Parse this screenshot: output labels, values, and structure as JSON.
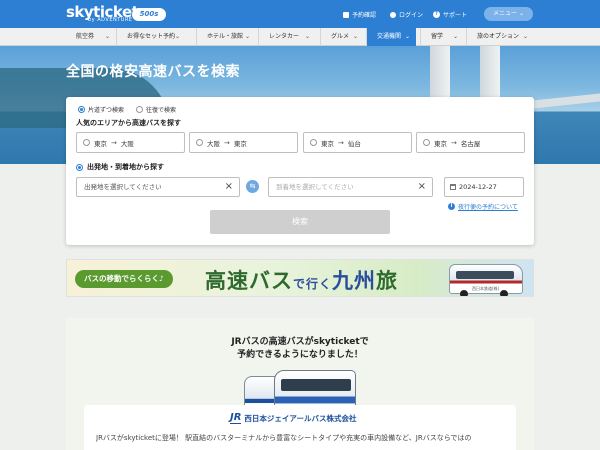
{
  "header": {
    "logo": "skyticket",
    "logo_sub": "by ADVENTURE",
    "badge": "500s",
    "links": [
      {
        "label": "予約確認",
        "icon": "document-icon"
      },
      {
        "label": "ログイン",
        "icon": "person-icon"
      },
      {
        "label": "サポート",
        "icon": "help-icon"
      }
    ],
    "menu_label": "メニュー ⌄"
  },
  "nav": {
    "items": [
      "航空券",
      "お得なセット予約",
      "ホテル・旅館",
      "レンタカー",
      "グルメ",
      "交通機関",
      "留学",
      "旅のオプション"
    ],
    "active_index": 5
  },
  "hero": {
    "title": "全国の格安高速バスを検索"
  },
  "search": {
    "trip_options": [
      "片道ずつ検索",
      "往復で検索"
    ],
    "selected_trip": 0,
    "popular_title": "人気のエリアから高速バスを探す",
    "routes": [
      {
        "from": "東京",
        "to": "大阪"
      },
      {
        "from": "大阪",
        "to": "東京"
      },
      {
        "from": "東京",
        "to": "仙台"
      },
      {
        "from": "東京",
        "to": "名古屋"
      }
    ],
    "od_title": "出発地・到着地から探す",
    "departure_placeholder": "出発地を選択してください",
    "arrival_placeholder": "到着地を選択してください",
    "date": "2024-12-27",
    "info_link": "夜行便の予約について",
    "search_button": "検索"
  },
  "banner": {
    "pill": "バスの移動でらくらく♪",
    "main_a": "高速バス",
    "main_b": "で行く",
    "main_c": "九州",
    "main_d": "旅",
    "bus_caption": "西日本鉄道(株)"
  },
  "jr": {
    "title_line1": "JRバスの高速バスがskyticketで",
    "title_line2": "予約できるようになりました！",
    "company": "西日本ジェイアールバス株式会社",
    "company_mark": "JR",
    "description": "JRバスがskyticketに登場！ 駅直結のバスターミナルから豊富なシートタイプや充実の車内設備など、JRバスならではの"
  },
  "colors": {
    "brand_blue": "#2d7fd4",
    "button_disabled": "#cfcfcf",
    "banner_green": "#5b9a2f"
  }
}
